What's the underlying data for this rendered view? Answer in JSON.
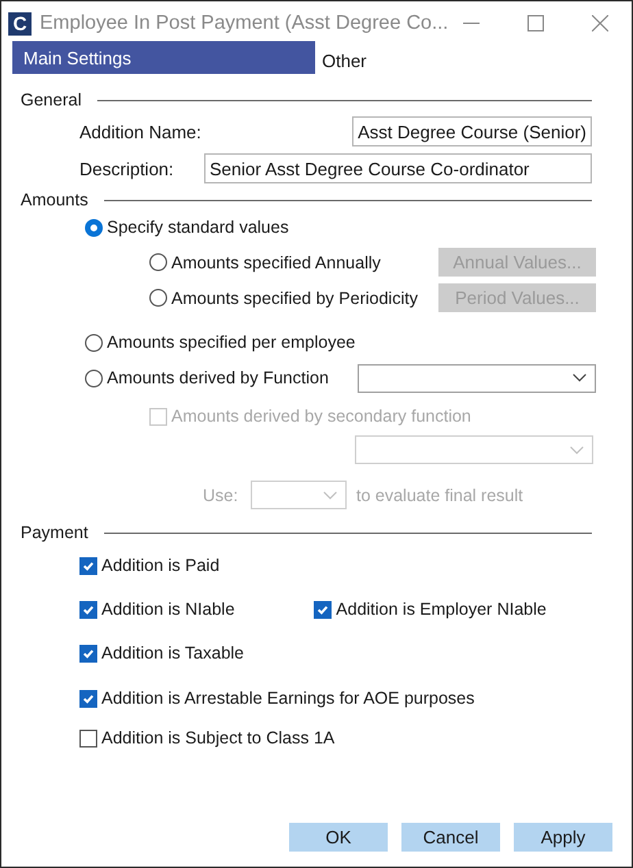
{
  "window": {
    "icon_text": "C",
    "title": "Employee In Post Payment (Asst Degree Co..."
  },
  "tabs": [
    {
      "label": "Main Settings",
      "selected": true
    },
    {
      "label": "Other",
      "selected": false
    }
  ],
  "general": {
    "heading": "General",
    "fields": [
      {
        "label": "Addition Name:",
        "value": "Asst Degree Course (Senior)"
      },
      {
        "label": "Description:",
        "value": "Senior Asst Degree Course Co-ordinator"
      }
    ]
  },
  "amounts": {
    "heading": "Amounts",
    "options": [
      {
        "label": "Specify standard values",
        "selected": true,
        "children": [
          {
            "label": "Amounts specified Annually",
            "selected": false,
            "button": {
              "label": "Annual Values...",
              "disabled": true
            }
          },
          {
            "label": "Amounts specified by Periodicity",
            "selected": false,
            "button": {
              "label": "Period Values...",
              "disabled": true
            }
          }
        ]
      },
      {
        "label": "Amounts specified per employee",
        "selected": false
      },
      {
        "label": "Amounts derived by Function",
        "selected": false,
        "dropdown": {
          "disabled": false
        }
      }
    ],
    "secondary": {
      "label": "Amounts derived by secondary function",
      "checked": false,
      "disabled": true,
      "dropdown": {
        "disabled": true
      }
    },
    "use": {
      "label": "Use:",
      "suffix": "to evaluate final result",
      "disabled": true
    }
  },
  "payment": {
    "heading": "Payment",
    "rows": [
      {
        "items": [
          {
            "label": "Addition is Paid",
            "checked": true
          }
        ]
      },
      {
        "items": [
          {
            "label": "Addition is NIable",
            "checked": true
          },
          {
            "label": "Addition is Employer NIable",
            "checked": true
          }
        ]
      },
      {
        "items": [
          {
            "label": "Addition is Taxable",
            "checked": true
          }
        ]
      },
      {
        "items": [
          {
            "label": "Addition is Arrestable Earnings for AOE purposes",
            "checked": true
          }
        ]
      },
      {
        "items": [
          {
            "label": "Addition is Subject to Class 1A",
            "checked": false
          }
        ]
      }
    ]
  },
  "buttons": [
    {
      "label": "OK"
    },
    {
      "label": "Cancel"
    },
    {
      "label": "Apply"
    }
  ]
}
